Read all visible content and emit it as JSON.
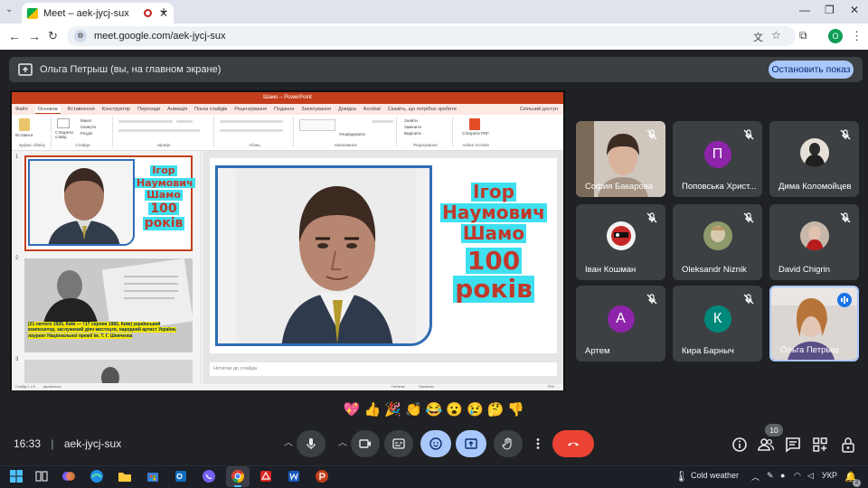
{
  "browser": {
    "tab_title": "Meet – aek-jycj-sux",
    "new_tab": "+",
    "url": "meet.google.com/aek-jycj-sux",
    "profile_initial": "O"
  },
  "meet": {
    "presenter_label": "Ольга Петрыш (вы, на главном экране)",
    "stop_button": "Остановить показ",
    "time": "16:33",
    "separator": "|",
    "meeting_code": "aek-jycj-sux",
    "participants_count": "10",
    "reactions": [
      "💖",
      "👍",
      "🎉",
      "👏",
      "😂",
      "😮",
      "😢",
      "🤔",
      "👎"
    ]
  },
  "presentation": {
    "app_title": "Шамо – PowerPoint",
    "ribbon_tabs": [
      "Файл",
      "Основна",
      "Вставлення",
      "Конструктор",
      "Переходи",
      "Анімація",
      "Показ слайдів",
      "Рецензування",
      "Подання",
      "Запитування",
      "Довідка",
      "Acrobat",
      "Скажіть, що потрібно зробити",
      "Спільний доступ"
    ],
    "ribbon_groups": [
      "Буфер обміну",
      "Слайди",
      "Шрифт",
      "Абзац",
      "Малювання",
      "Редагування",
      "Adobe Acrobat"
    ],
    "ribbon_buttons": {
      "paste": "Вставити",
      "new_slide": "Створити слайд",
      "layout": "Макет",
      "reset": "Скинути",
      "section": "Розділ",
      "arrange": "Упорядкувати",
      "find": "Знайти",
      "replace": "Замінити",
      "select": "Виділити",
      "create_pdf": "Створити PDF"
    },
    "slide_title_lines": [
      "Ігор",
      "Наумович",
      "Шамо",
      "100",
      "років"
    ],
    "thumb2_caption": "(21 лютого 1925, Київ — †17 серпня 1982, Київ) український композитор, заслужений діяч мистецтв, народний артист України, лауреат Національної премії ім. Т. Г. Шевченка",
    "thumb_numbers": [
      "1",
      "2",
      "3"
    ],
    "notes_placeholder": "Нотатки до слайда",
    "status_text": "Слайд 1 з 5",
    "status_lang": "українська",
    "status_notes": "Нотатки",
    "status_comments": "Примітки",
    "zoom": "75%"
  },
  "participants": [
    {
      "name": "София Бакарова",
      "type": "photo",
      "muted": true
    },
    {
      "name": "Поповська Христ...",
      "initial": "П",
      "color": "#8e24aa",
      "muted": true
    },
    {
      "name": "Дима Коломойцев",
      "type": "photo",
      "muted": true
    },
    {
      "name": "Іван Кошман",
      "type": "photo",
      "muted": true
    },
    {
      "name": "Oleksandr Niznik",
      "type": "photo",
      "muted": true
    },
    {
      "name": "David Chigrin",
      "type": "photo",
      "muted": true
    },
    {
      "name": "Артем",
      "initial": "А",
      "color": "#8e24aa",
      "muted": true
    },
    {
      "name": "Кира Барныч",
      "initial": "К",
      "color": "#00897b",
      "muted": true
    },
    {
      "name": "Ольга Петрыш",
      "type": "photo",
      "speaking": true
    }
  ],
  "taskbar": {
    "weather": "Cold weather",
    "lang": "УКР",
    "notif_count": "2"
  },
  "colors": {
    "meet_bg": "#202124",
    "stop_button_bg": "#a8c7fa",
    "end_call_red": "#ea4335",
    "active_blue": "#a8c7fa",
    "ppt_red": "#c43e1c",
    "slide_title_red": "#c0392b",
    "slide_title_highlight": "#3ee0f0"
  }
}
